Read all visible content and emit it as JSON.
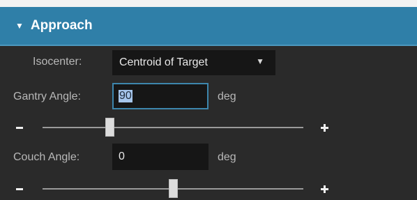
{
  "section": {
    "title": "Approach",
    "caret_glyph": "▼"
  },
  "isocenter": {
    "label": "Isocenter:",
    "value": "Centroid of Target",
    "arrow_glyph": "▼"
  },
  "gantry": {
    "label": "Gantry Angle:",
    "value": "90",
    "unit": "deg",
    "slider_fraction": 0.25
  },
  "couch": {
    "label": "Couch Angle:",
    "value": "0",
    "unit": "deg",
    "slider_fraction": 0.5
  },
  "colors": {
    "header": "#2f7fa8",
    "background": "#2a2a2a",
    "field": "#161616",
    "focus_border": "#3d86ad"
  }
}
